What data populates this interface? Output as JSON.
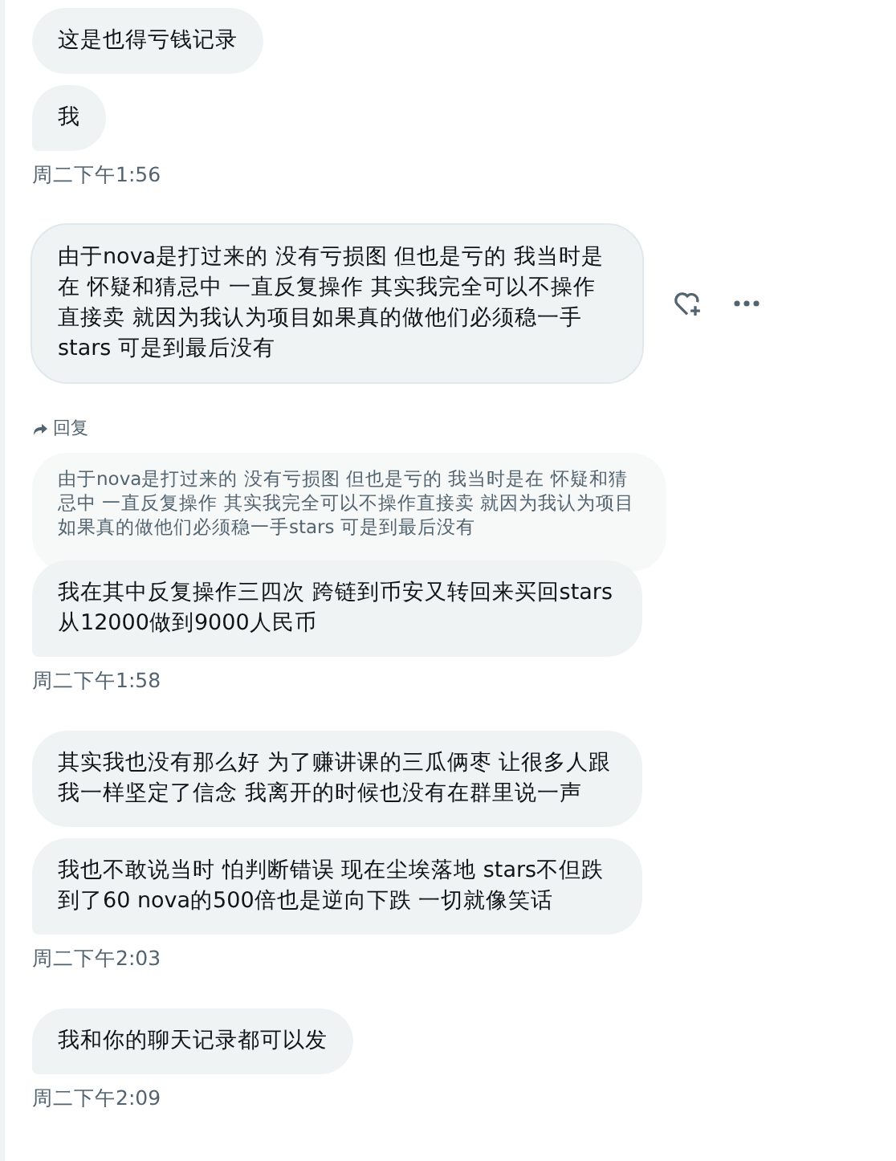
{
  "groups": [
    {
      "messages": [
        {
          "text": "这是也得亏钱记录",
          "hovered": false
        },
        {
          "text": "我",
          "hovered": false
        }
      ],
      "time": "周二下午1:56"
    },
    {
      "messages": [
        {
          "text": "由于nova是打过来的 没有亏损图 但也是亏的 我当时是在 怀疑和猜忌中 一直反复操作 其实我完全可以不操作直接卖 就因为我认为项目如果真的做他们必须稳一手stars 可是到最后没有",
          "hovered": true
        },
        {
          "text": "我在其中反复操作三四次 跨链到币安又转回来买回stars 从12000做到9000人民币",
          "hovered": false,
          "reply": {
            "label": "回复",
            "quote": "由于nova是打过来的 没有亏损图 但也是亏的 我当时是在 怀疑和猜忌中 一直反复操作 其实我完全可以不操作直接卖 就因为我认为项目如果真的做他们必须稳一手stars 可是到最后没有"
          }
        }
      ],
      "time": "周二下午1:58"
    },
    {
      "messages": [
        {
          "text": "其实我也没有那么好 为了赚讲课的三瓜俩枣 让很多人跟我一样坚定了信念 我离开的时候也没有在群里说一声",
          "hovered": false
        },
        {
          "text": "我也不敢说当时 怕判断错误 现在尘埃落地 stars不但跌到了60 nova的500倍也是逆向下跌 一切就像笑话",
          "hovered": false
        }
      ],
      "time": "周二下午2:03"
    },
    {
      "messages": [
        {
          "text": "我和你的聊天记录都可以发",
          "hovered": false
        }
      ],
      "time": "周二下午2:09"
    }
  ]
}
